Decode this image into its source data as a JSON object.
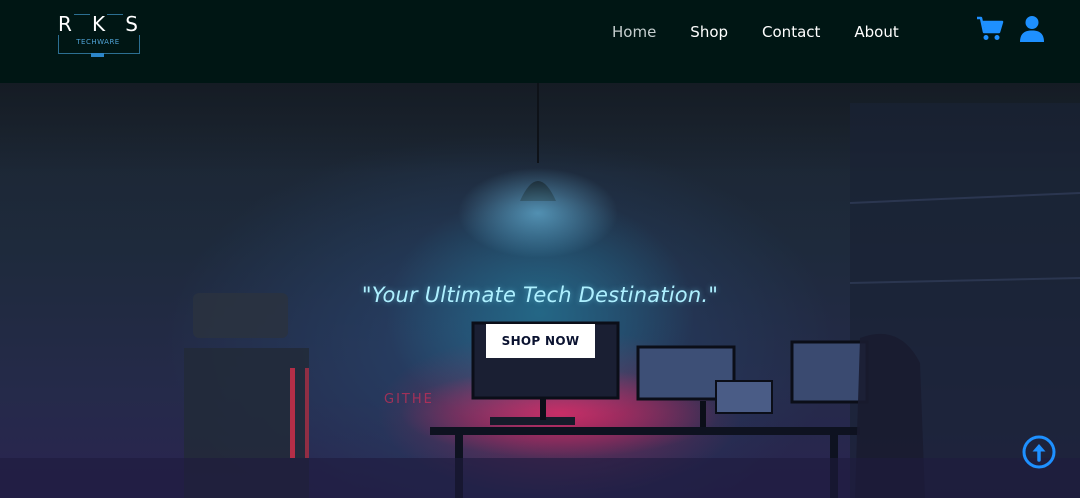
{
  "brand": {
    "letters": [
      "R",
      "K",
      "S"
    ],
    "subtitle": "TECHWARE"
  },
  "nav": {
    "items": [
      {
        "label": "Home",
        "active": true
      },
      {
        "label": "Shop",
        "active": false
      },
      {
        "label": "Contact",
        "active": false
      },
      {
        "label": "About",
        "active": false
      }
    ],
    "cart_icon": "cart-icon",
    "user_icon": "user-icon"
  },
  "hero": {
    "tagline": "\"Your Ultimate Tech Destination.\"",
    "cta_label": "SHOP NOW",
    "sign_text": "GITHE",
    "scroll_top_icon": "arrow-up-circle-icon"
  },
  "colors": {
    "header_bg": "#001614",
    "accent_blue": "#1e90ff",
    "tagline": "#aef0ff",
    "cta_bg": "#ffffff",
    "cta_text": "#0a1230"
  }
}
